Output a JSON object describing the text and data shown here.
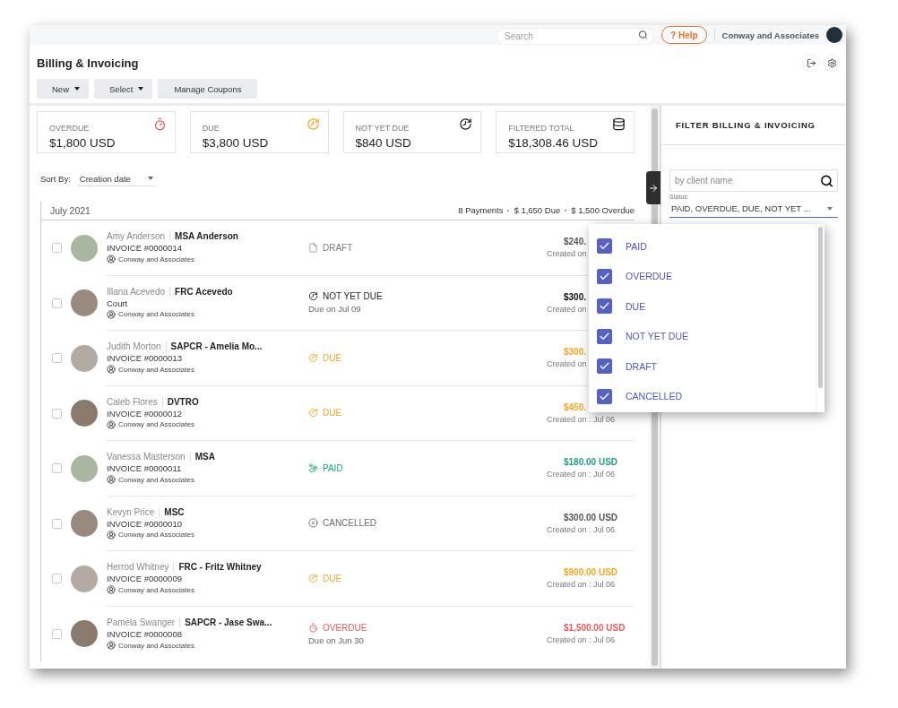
{
  "top_bar": {
    "search": {
      "placeholder": "Search"
    },
    "help_label": "? Help",
    "account": "Conway and Associates"
  },
  "page": {
    "title": "Billing & Invoicing",
    "actions": [
      {
        "label": "New",
        "dropdown": true
      },
      {
        "label": "Select",
        "dropdown": true
      },
      {
        "label": "Manage Coupons",
        "dropdown": false
      }
    ]
  },
  "summary_cards": [
    {
      "kind": "overdue",
      "label": "OVERDUE",
      "amount": "$1,800 USD"
    },
    {
      "kind": "due",
      "label": "DUE",
      "amount": "$3,800 USD"
    },
    {
      "kind": "not_yet_due",
      "label": "NOT YET DUE",
      "amount": "$840 USD"
    },
    {
      "kind": "total",
      "label": "FILTERED TOTAL",
      "amount": "$18,308.46 USD"
    }
  ],
  "sort": {
    "label": "Sort By:",
    "value": "Creation date"
  },
  "group": {
    "title": "July 2021",
    "stats": [
      "8 Payments",
      "$ 1,650 Due",
      "$ 1,500 Overdue"
    ]
  },
  "invoices": [
    {
      "checked": false,
      "client": "Amy Anderson",
      "matter": "MSA Anderson",
      "reference": "INVOICE #0000014",
      "firm": "Conway and Associates",
      "kind": "draft",
      "status_label": "DRAFT",
      "amount": "$240.",
      "created": "Created on"
    },
    {
      "checked": false,
      "client": "Illana Acevedo",
      "matter": "FRC Acevedo",
      "reference": "Court",
      "firm": "Conway and Associates",
      "kind": "not_yet_due",
      "status_label": "NOT YET DUE",
      "due": "Due on Jul 09",
      "amount": "$300.",
      "created": "Created on"
    },
    {
      "checked": false,
      "client": "Judith Morton",
      "matter": "SAPCR - Amelia Mo...",
      "reference": "INVOICE #0000013",
      "firm": "Conway and Associates",
      "kind": "due",
      "status_label": "DUE",
      "amount": "$300.",
      "created": "Created on"
    },
    {
      "checked": false,
      "client": "Caleb Flores",
      "matter": "DVTRO",
      "reference": "INVOICE #0000012",
      "firm": "Conway and Associates",
      "kind": "due",
      "status_label": "DUE",
      "amount": "$450.",
      "created": "Created on : Jul 06"
    },
    {
      "checked": false,
      "client": "Vanessa Masterson",
      "matter": "MSA",
      "reference": "INVOICE #0000011",
      "firm": "Conway and Associates",
      "kind": "paid",
      "status_label": "PAID",
      "amount": "$180.00 USD",
      "created": "Created on : Jul 06"
    },
    {
      "checked": false,
      "client": "Kevyn Price",
      "matter": "MSC",
      "reference": "INVOICE #0000010",
      "firm": "Conway and Associates",
      "kind": "cancelled",
      "status_label": "CANCELLED",
      "amount": "$300.00 USD",
      "created": "Created on : Jul 06"
    },
    {
      "checked": false,
      "client": "Herrod Whitney",
      "matter": "FRC - Fritz Whitney",
      "reference": "INVOICE #0000009",
      "firm": "Conway and Associates",
      "kind": "due",
      "status_label": "DUE",
      "amount": "$900.00 USD",
      "created": "Created on : Jul 06"
    },
    {
      "checked": false,
      "client": "Pamela Swanger",
      "matter": "SAPCR - Jase Swa...",
      "reference": "INVOICE #0000008",
      "firm": "Conway and Associates",
      "kind": "overdue",
      "status_label": "OVERDUE",
      "due": "Due on Jun 30",
      "amount": "$1,500.00 USD",
      "created": "Created on : Jul 06"
    }
  ],
  "filter_panel": {
    "title": "FILTER BILLING & INVOICING",
    "search": {
      "placeholder": "by client name"
    },
    "status_label": "Status:",
    "status_value": "PAID, OVERDUE, DUE, NOT YET ...",
    "status_options": [
      {
        "label": "PAID",
        "checked": true
      },
      {
        "label": "OVERDUE",
        "checked": true
      },
      {
        "label": "DUE",
        "checked": true
      },
      {
        "label": "NOT YET DUE",
        "checked": true
      },
      {
        "label": "DRAFT",
        "checked": true
      },
      {
        "label": "CANCELLED",
        "checked": true
      }
    ]
  }
}
